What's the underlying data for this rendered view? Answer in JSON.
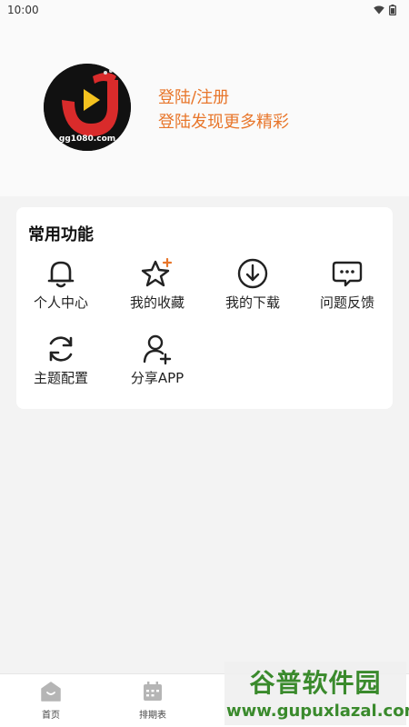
{
  "status_bar": {
    "time": "10:00"
  },
  "header": {
    "login_title": "登陆/注册",
    "login_subtitle": "登陆发现更多精彩",
    "avatar_text": "gg1080.com"
  },
  "features": {
    "title": "常用功能",
    "items": [
      {
        "label": "个人中心",
        "icon": "bell-icon"
      },
      {
        "label": "我的收藏",
        "icon": "star-icon"
      },
      {
        "label": "我的下载",
        "icon": "download-icon"
      },
      {
        "label": "问题反馈",
        "icon": "chat-icon"
      },
      {
        "label": "主题配置",
        "icon": "refresh-icon"
      },
      {
        "label": "分享APP",
        "icon": "add-user-icon"
      }
    ]
  },
  "bottom_nav": {
    "items": [
      {
        "label": "首页",
        "icon": "home-icon"
      },
      {
        "label": "排期表",
        "icon": "calendar-icon"
      }
    ]
  },
  "watermark": {
    "title": "谷普软件园",
    "url": "www.gupuxlazal.com"
  },
  "colors": {
    "accent": "#e8762b",
    "watermark_green": "#3a8a2c"
  }
}
